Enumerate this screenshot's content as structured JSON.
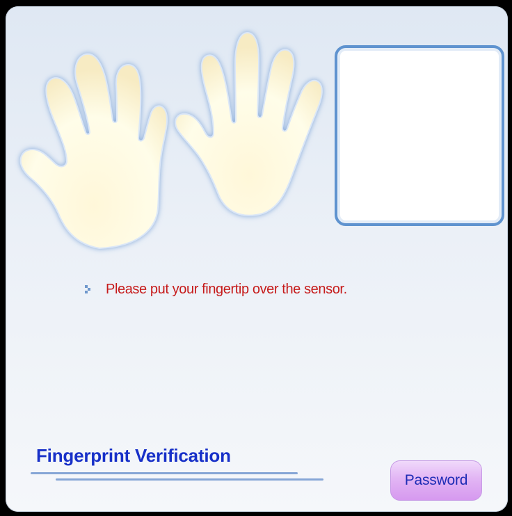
{
  "colors": {
    "background_top": "#dfe8f3",
    "background_bottom": "#f5f7fa",
    "sensor_frame": "#5f93cf",
    "instruction_text": "#c61b1b",
    "title_text": "#1730c8",
    "password_button": "#e2b5f4"
  },
  "header": {
    "left_hand_icon": "left-hand-icon",
    "right_hand_icon": "right-hand-icon",
    "sensor_preview": "fingerprint-sensor-preview"
  },
  "instruction": {
    "bullet_icon": "bullet-arrow-icon",
    "text": "Please put your fingertip over the sensor."
  },
  "footer": {
    "title": "Fingerprint Verification",
    "password_button": "Password"
  }
}
